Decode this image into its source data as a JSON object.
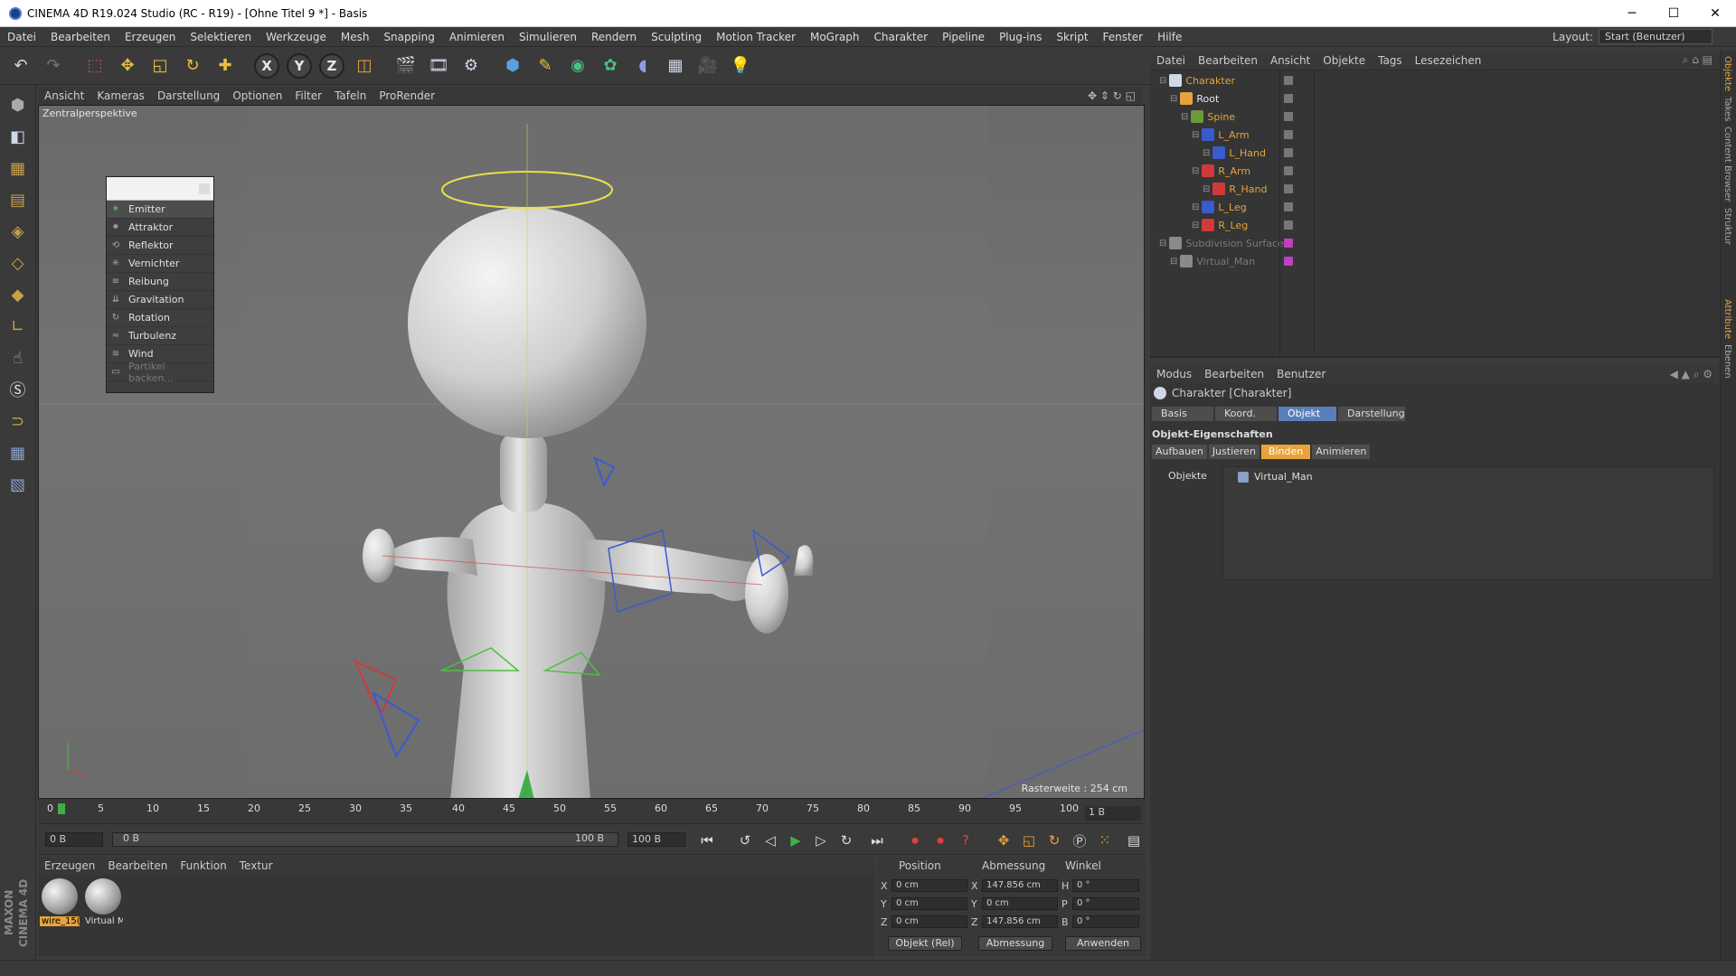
{
  "window": {
    "title": "CINEMA 4D R19.024 Studio (RC - R19) - [Ohne Titel 9 *] - Basis",
    "min": "─",
    "max": "☐",
    "close": "✕"
  },
  "menu": [
    "Datei",
    "Bearbeiten",
    "Erzeugen",
    "Selektieren",
    "Werkzeuge",
    "Mesh",
    "Snapping",
    "Animieren",
    "Simulieren",
    "Rendern",
    "Sculpting",
    "Motion Tracker",
    "MoGraph",
    "Charakter",
    "Pipeline",
    "Plug-ins",
    "Skript",
    "Fenster",
    "Hilfe"
  ],
  "layout": {
    "label": "Layout:",
    "value": "Start (Benutzer)"
  },
  "toolbar": {
    "axes": [
      "X",
      "Y",
      "Z"
    ]
  },
  "viewport": {
    "menu": [
      "Ansicht",
      "Kameras",
      "Darstellung",
      "Optionen",
      "Filter",
      "Tafeln",
      "ProRender"
    ],
    "label": "Zentralperspektive",
    "raster": "Rasterweite : 254 cm"
  },
  "popup": {
    "items": [
      "Emitter",
      "Attraktor",
      "Reflektor",
      "Vernichter",
      "Reibung",
      "Gravitation",
      "Rotation",
      "Turbulenz",
      "Wind",
      "Partikel backen..."
    ]
  },
  "timeline": {
    "ticks": [
      "0",
      "5",
      "10",
      "15",
      "20",
      "25",
      "30",
      "35",
      "40",
      "45",
      "50",
      "55",
      "60",
      "65",
      "70",
      "75",
      "80",
      "85",
      "90",
      "95",
      "100"
    ],
    "frame_end": "1 B"
  },
  "transport": {
    "current": "0 B",
    "range_start": "0 B",
    "range_end": "100 B",
    "max": "100 B"
  },
  "materials": {
    "menu": [
      "Erzeugen",
      "Bearbeiten",
      "Funktion",
      "Textur"
    ],
    "items": [
      "wire_15(",
      "Virtual M"
    ]
  },
  "coords": {
    "headers": [
      "Position",
      "Abmessung",
      "Winkel"
    ],
    "rows": [
      {
        "axis": "X",
        "pos": "0 cm",
        "dimlbl": "X",
        "dim": "147.856 cm",
        "anglbl": "H",
        "ang": "0 °"
      },
      {
        "axis": "Y",
        "pos": "0 cm",
        "dimlbl": "Y",
        "dim": "0 cm",
        "anglbl": "P",
        "ang": "0 °"
      },
      {
        "axis": "Z",
        "pos": "0 cm",
        "dimlbl": "Z",
        "dim": "147.856 cm",
        "anglbl": "B",
        "ang": "0 °"
      }
    ],
    "mode1": "Objekt (Rel)",
    "mode2": "Abmessung",
    "apply": "Anwenden"
  },
  "objects": {
    "menu": [
      "Datei",
      "Bearbeiten",
      "Ansicht",
      "Objekte",
      "Tags",
      "Lesezeichen"
    ],
    "tree": [
      {
        "label": "Charakter",
        "depth": 0,
        "color": "#cfd8e8",
        "style": "orange"
      },
      {
        "label": "Root",
        "depth": 1,
        "color": "#e8a33a",
        "style": "white"
      },
      {
        "label": "Spine",
        "depth": 2,
        "color": "#6a9a3a",
        "style": "orange"
      },
      {
        "label": "L_Arm",
        "depth": 3,
        "color": "#3a5ad0",
        "style": "orange"
      },
      {
        "label": "L_Hand",
        "depth": 4,
        "color": "#3a5ad0",
        "style": "orange"
      },
      {
        "label": "R_Arm",
        "depth": 3,
        "color": "#d03a3a",
        "style": "orange"
      },
      {
        "label": "R_Hand",
        "depth": 4,
        "color": "#d03a3a",
        "style": "orange"
      },
      {
        "label": "L_Leg",
        "depth": 3,
        "color": "#3a5ad0",
        "style": "orange"
      },
      {
        "label": "R_Leg",
        "depth": 3,
        "color": "#d03a3a",
        "style": "orange"
      },
      {
        "label": "Subdivision Surface",
        "depth": 0,
        "color": "#8a8a8a",
        "style": "dim"
      },
      {
        "label": "Virtual_Man",
        "depth": 1,
        "color": "#8a8a8a",
        "style": "dim"
      }
    ]
  },
  "attributes": {
    "menu": [
      "Modus",
      "Bearbeiten",
      "Benutzer"
    ],
    "title": "Charakter [Charakter]",
    "tabs": [
      "Basis",
      "Koord.",
      "Objekt",
      "Darstellung"
    ],
    "section": "Objekt-Eigenschaften",
    "subtabs": [
      "Aufbauen",
      "Justieren",
      "Binden",
      "Animieren"
    ],
    "objects_label": "Objekte",
    "object_entry": "Virtual_Man"
  },
  "right_strip": [
    "Objekte",
    "Takes",
    "Content Browser",
    "Struktur",
    "Attribute",
    "Ebenen"
  ]
}
